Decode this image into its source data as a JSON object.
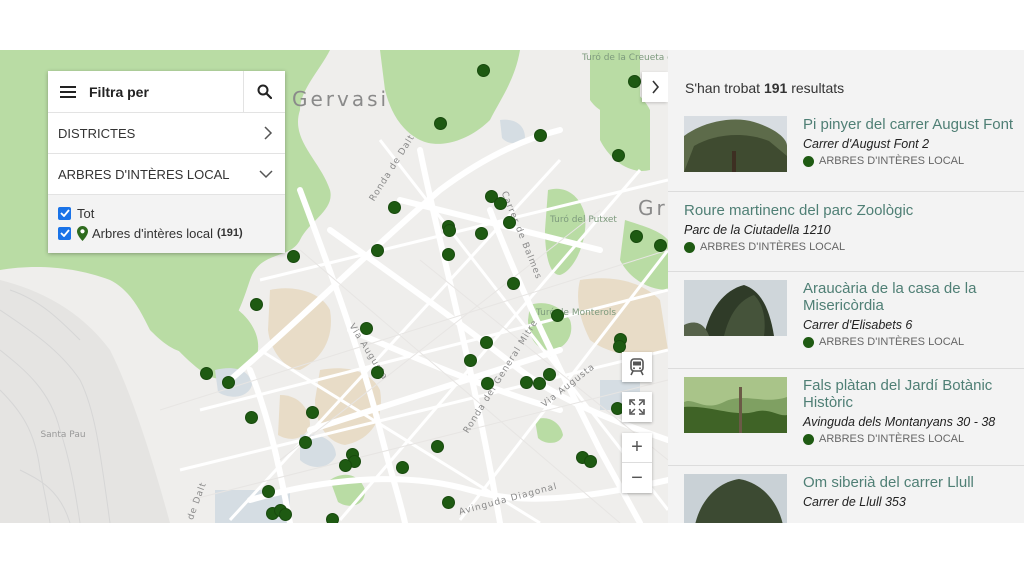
{
  "map": {
    "place_labels": [
      "Gervasi",
      "Gr"
    ],
    "street_labels": [
      "Ronda de Dalt",
      "Carrer de Balmes",
      "Via Augusta",
      "Ronda del General Mitre",
      "Via Augusta",
      "Avinguda Diagonal",
      "de Dalt"
    ],
    "small_labels": [
      "Turó de la Creueta del Coll",
      "Turó del Putxet",
      "Turó de Monterols",
      "Santa Pau"
    ],
    "marker_color": "#1e5a12",
    "controls": {
      "zoom_in": "+",
      "zoom_out": "−"
    }
  },
  "filter": {
    "title": "Filtra per",
    "rows": [
      {
        "label": "DISTRICTES",
        "icon": "chevron-right-icon"
      },
      {
        "label": "ARBRES D'INTÈRES LOCAL",
        "icon": "chevron-down-icon"
      }
    ],
    "checks": [
      {
        "label": "Tot",
        "checked": true
      },
      {
        "label": "Arbres d'intères local",
        "count": "(191)",
        "checked": true
      }
    ]
  },
  "results": {
    "prefix": "S'han trobat",
    "count": "191",
    "suffix": "resultats",
    "items": [
      {
        "name": "Pi pinyer del carrer August Font",
        "address": "Carrer d'August Font 2",
        "category": "ARBRES D'INTÈRES LOCAL",
        "has_photo": true
      },
      {
        "name": "Roure martinenc del parc Zoològic",
        "address": "Parc de la Ciutadella 1210",
        "category": "ARBRES D'INTÈRES LOCAL",
        "has_photo": false
      },
      {
        "name": "Araucària de la casa de la Misericòrdia",
        "address": "Carrer d'Elisabets 6",
        "category": "ARBRES D'INTÈRES LOCAL",
        "has_photo": true
      },
      {
        "name": "Fals plàtan del Jardí Botànic Històric",
        "address": "Avinguda dels Montanyans 30 - 38",
        "category": "ARBRES D'INTÈRES LOCAL",
        "has_photo": true
      },
      {
        "name": "Om siberià del carrer Llull",
        "address": "Carrer de Llull 353",
        "category": "",
        "has_photo": true
      }
    ]
  },
  "colors": {
    "accent_link": "#4f7f75",
    "park_green": "#b9dca4",
    "checkbox_blue": "#1a73e8"
  }
}
